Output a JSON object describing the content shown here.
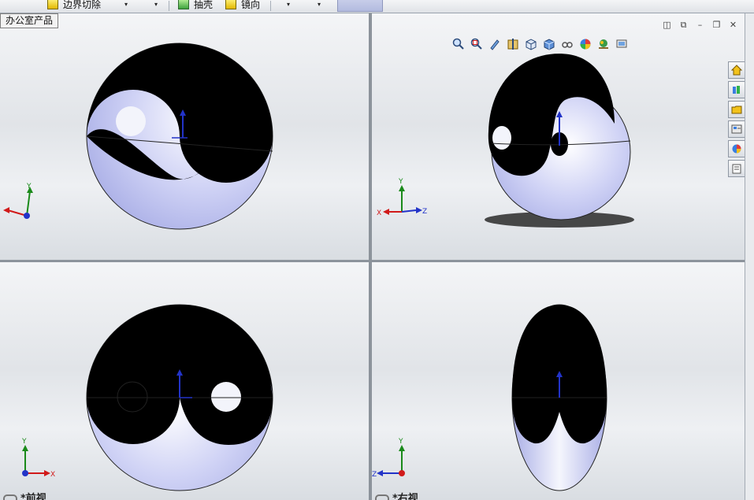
{
  "toolbar": {
    "boundary_cut_label": "边界切除",
    "shell_label": "抽壳",
    "mirror_label": "镜向"
  },
  "document_tab": "办公室产品",
  "views": {
    "top_left": {
      "triad": [
        "Y"
      ]
    },
    "top_right": {
      "triad": [
        "Y",
        "X",
        "Z"
      ]
    },
    "bottom_left": {
      "label": "*前视",
      "triad": [
        "Y",
        "X"
      ]
    },
    "bottom_right": {
      "label": "*右视",
      "triad": [
        "Y",
        "Z"
      ]
    }
  },
  "heads_up_toolbar": {
    "icons": [
      "zoom-to-fit-icon",
      "zoom-to-area-icon",
      "previous-view-icon",
      "section-view-icon",
      "view-orientation-icon",
      "display-style-icon",
      "hide-show-icon",
      "edit-appearance-icon",
      "apply-scene-icon",
      "view-settings-icon"
    ]
  },
  "task_pane": {
    "icons": [
      "home-icon",
      "design-library-icon",
      "file-explorer-icon",
      "view-palette-icon",
      "appearances-icon",
      "custom-properties-icon"
    ]
  },
  "colors": {
    "yin": "#000000",
    "yang": "#c9cdf4",
    "x_axis": "#d11a1a",
    "y_axis": "#1a8a1a",
    "z_axis": "#2233c8"
  }
}
